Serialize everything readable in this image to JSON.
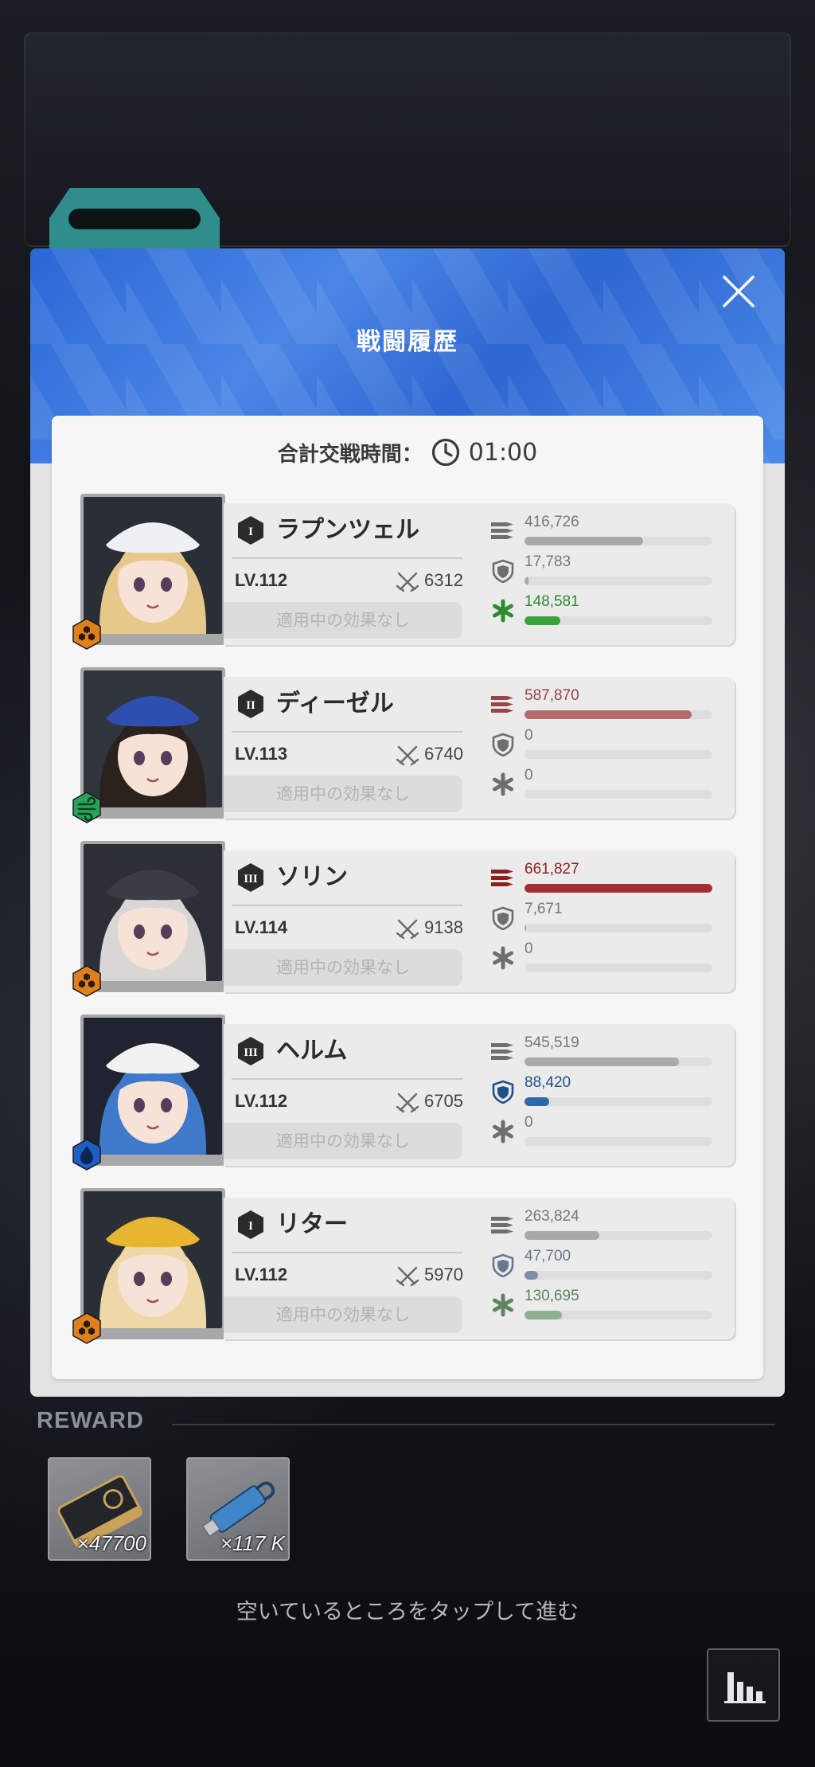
{
  "modal": {
    "title": "戦闘履歴",
    "duration_label": "合計交戦時間：",
    "duration_value": "01:00",
    "icons": {
      "close": "close-icon",
      "duration": "clock-icon"
    }
  },
  "units": [
    {
      "rank": "I",
      "name": "ラプンツェル",
      "level": "LV.112",
      "combat_power": "6312",
      "effect": "適用中の効果なし",
      "class_icon": "supporter-class-icon",
      "class_color": "#e0801c",
      "portrait_colors": {
        "hair": "#e6c98a",
        "hat": "#eef0f4",
        "bg": "#2a2f36"
      },
      "stats": {
        "damage": {
          "value": "416,726",
          "ratio": 0.63,
          "color": "#a9a9a9",
          "text_color": "#777777"
        },
        "taken": {
          "value": "17,783",
          "ratio": 0.02,
          "color": "#a9a9a9",
          "text_color": "#777777"
        },
        "heal": {
          "value": "148,581",
          "ratio": 0.19,
          "color": "#3aa33a",
          "text_color": "#2e8a2e"
        }
      }
    },
    {
      "rank": "II",
      "name": "ディーゼル",
      "level": "LV.113",
      "combat_power": "6740",
      "effect": "適用中の効果なし",
      "class_icon": "wind-element-icon",
      "class_color": "#27a35a",
      "portrait_colors": {
        "hair": "#2b211d",
        "hat": "#2f4fb0",
        "bg": "#30343c"
      },
      "stats": {
        "damage": {
          "value": "587,870",
          "ratio": 0.89,
          "color": "#b46a6a",
          "text_color": "#9a4444"
        },
        "taken": {
          "value": "0",
          "ratio": 0,
          "color": "#a9a9a9",
          "text_color": "#777777"
        },
        "heal": {
          "value": "0",
          "ratio": 0,
          "color": "#a9a9a9",
          "text_color": "#777777"
        }
      }
    },
    {
      "rank": "III",
      "name": "ソリン",
      "level": "LV.114",
      "combat_power": "9138",
      "effect": "適用中の効果なし",
      "class_icon": "supporter-class-icon",
      "class_color": "#e0801c",
      "portrait_colors": {
        "hair": "#d9d6d6",
        "hat": "#3a3d44",
        "bg": "#2c2f35"
      },
      "stats": {
        "damage": {
          "value": "661,827",
          "ratio": 1.0,
          "color": "#a33030",
          "text_color": "#8e1f1f"
        },
        "taken": {
          "value": "7,671",
          "ratio": 0.01,
          "color": "#a9a9a9",
          "text_color": "#777777"
        },
        "heal": {
          "value": "0",
          "ratio": 0,
          "color": "#a9a9a9",
          "text_color": "#777777"
        }
      }
    },
    {
      "rank": "III",
      "name": "ヘルム",
      "level": "LV.112",
      "combat_power": "6705",
      "effect": "適用中の効果なし",
      "class_icon": "water-element-icon",
      "class_color": "#1d5fc4",
      "portrait_colors": {
        "hair": "#3f79c9",
        "hat": "#f1f1f1",
        "bg": "#1f2430"
      },
      "stats": {
        "damage": {
          "value": "545,519",
          "ratio": 0.82,
          "color": "#a9a9a9",
          "text_color": "#777777"
        },
        "taken": {
          "value": "88,420",
          "ratio": 0.13,
          "color": "#2f68a8",
          "text_color": "#23508a"
        },
        "heal": {
          "value": "0",
          "ratio": 0,
          "color": "#a9a9a9",
          "text_color": "#777777"
        }
      }
    },
    {
      "rank": "I",
      "name": "リター",
      "level": "LV.112",
      "combat_power": "5970",
      "effect": "適用中の効果なし",
      "class_icon": "supporter-class-icon",
      "class_color": "#e0801c",
      "portrait_colors": {
        "hair": "#efd8a8",
        "hat": "#e8b530",
        "bg": "#2a2e35"
      },
      "stats": {
        "damage": {
          "value": "263,824",
          "ratio": 0.4,
          "color": "#a9a9a9",
          "text_color": "#777777"
        },
        "taken": {
          "value": "47,700",
          "ratio": 0.07,
          "color": "#7f8fa6",
          "text_color": "#6a7790"
        },
        "heal": {
          "value": "130,695",
          "ratio": 0.2,
          "color": "#8fb08f",
          "text_color": "#5f845f"
        }
      }
    }
  ],
  "stat_icons": {
    "damage": "ammo-icon",
    "taken": "shield-icon",
    "heal": "heal-cross-icon"
  },
  "reward": {
    "label": "REWARD",
    "items": [
      {
        "icon": "credit-card-icon",
        "quantity": "×47700"
      },
      {
        "icon": "data-drive-icon",
        "quantity": "×117 K"
      }
    ]
  },
  "hint": "空いているところをタップして進む",
  "stats_button_icon": "bar-chart-icon",
  "colors": {
    "header_blue": "#2f6dd8",
    "panel": "#f6f6f6"
  }
}
